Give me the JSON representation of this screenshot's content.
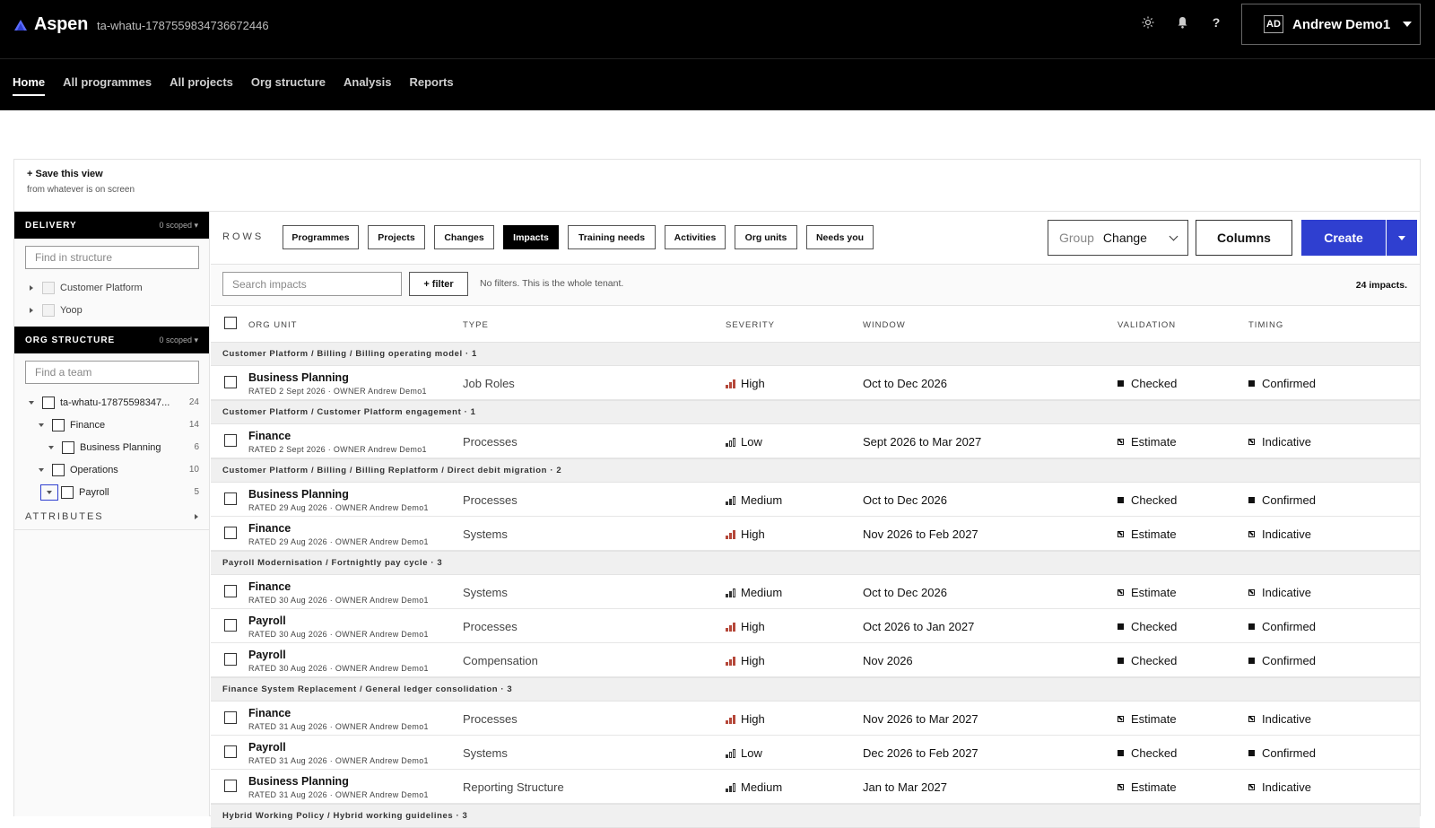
{
  "app": {
    "brand": "Aspen",
    "tenant": "ta-whatu-1787559834736672446",
    "user_initials": "AD",
    "user_name": "Andrew Demo1"
  },
  "nav": [
    {
      "label": "Home",
      "active": true
    },
    {
      "label": "All programmes"
    },
    {
      "label": "All projects"
    },
    {
      "label": "Org structure"
    },
    {
      "label": "Analysis"
    },
    {
      "label": "Reports"
    }
  ],
  "save_view": {
    "title": "+ Save this view",
    "subtitle": "from whatever is on screen"
  },
  "sidebar": {
    "delivery": {
      "title": "DELIVERY",
      "scope": "0 scoped",
      "placeholder": "Find in structure",
      "items": [
        {
          "label": "Customer Platform"
        },
        {
          "label": "Yoop"
        }
      ]
    },
    "org": {
      "title": "ORG STRUCTURE",
      "scope": "0 scoped",
      "placeholder": "Find a team",
      "items": [
        {
          "label": "ta-whatu-17875598347...",
          "count": "24"
        },
        {
          "label": "Finance",
          "count": "14"
        },
        {
          "label": "Business Planning",
          "count": "6"
        },
        {
          "label": "Operations",
          "count": "10"
        },
        {
          "label": "Payroll",
          "count": "5"
        }
      ]
    },
    "attributes": "ATTRIBUTES"
  },
  "rows": {
    "label": "ROWS",
    "buttons": [
      "Programmes",
      "Projects",
      "Changes",
      "Impacts",
      "Training needs",
      "Activities",
      "Org units",
      "Needs you"
    ],
    "active": "Impacts"
  },
  "toolbar": {
    "group_label": "Group",
    "group_value": "Change",
    "columns": "Columns",
    "create": "Create"
  },
  "filter": {
    "search_placeholder": "Search impacts",
    "filter_btn": "+ filter",
    "note": "No filters. This is the whole tenant.",
    "count": "24 impacts."
  },
  "table": {
    "headers": [
      "ORG UNIT",
      "TYPE",
      "SEVERITY",
      "WINDOW",
      "VALIDATION",
      "TIMING"
    ],
    "groups": [
      {
        "title": "Customer Platform / Billing / Billing operating model · 1",
        "rows": [
          {
            "unit": "Business Planning",
            "meta": "RATED 2 Sept 2026 · OWNER Andrew Demo1",
            "type": "Job Roles",
            "severity": "High",
            "window": "Oct to Dec 2026",
            "validation": "Checked",
            "timing": "Confirmed"
          }
        ]
      },
      {
        "title": "Customer Platform / Customer Platform engagement · 1",
        "rows": [
          {
            "unit": "Finance",
            "meta": "RATED 2 Sept 2026 · OWNER Andrew Demo1",
            "type": "Processes",
            "severity": "Low",
            "window": "Sept 2026 to Mar 2027",
            "validation": "Estimate",
            "timing": "Indicative"
          }
        ]
      },
      {
        "title": "Customer Platform / Billing / Billing Replatform / Direct debit migration · 2",
        "rows": [
          {
            "unit": "Business Planning",
            "meta": "RATED 29 Aug 2026 · OWNER Andrew Demo1",
            "type": "Processes",
            "severity": "Medium",
            "window": "Oct to Dec 2026",
            "validation": "Checked",
            "timing": "Confirmed"
          },
          {
            "unit": "Finance",
            "meta": "RATED 29 Aug 2026 · OWNER Andrew Demo1",
            "type": "Systems",
            "severity": "High",
            "window": "Nov 2026 to Feb 2027",
            "validation": "Estimate",
            "timing": "Indicative"
          }
        ]
      },
      {
        "title": "Payroll Modernisation / Fortnightly pay cycle · 3",
        "rows": [
          {
            "unit": "Finance",
            "meta": "RATED 30 Aug 2026 · OWNER Andrew Demo1",
            "type": "Systems",
            "severity": "Medium",
            "window": "Oct to Dec 2026",
            "validation": "Estimate",
            "timing": "Indicative"
          },
          {
            "unit": "Payroll",
            "meta": "RATED 30 Aug 2026 · OWNER Andrew Demo1",
            "type": "Processes",
            "severity": "High",
            "window": "Oct 2026 to Jan 2027",
            "validation": "Checked",
            "timing": "Confirmed"
          },
          {
            "unit": "Payroll",
            "meta": "RATED 30 Aug 2026 · OWNER Andrew Demo1",
            "type": "Compensation",
            "severity": "High",
            "window": "Nov 2026",
            "validation": "Checked",
            "timing": "Confirmed"
          }
        ]
      },
      {
        "title": "Finance System Replacement / General ledger consolidation · 3",
        "rows": [
          {
            "unit": "Finance",
            "meta": "RATED 31 Aug 2026 · OWNER Andrew Demo1",
            "type": "Processes",
            "severity": "High",
            "window": "Nov 2026 to Mar 2027",
            "validation": "Estimate",
            "timing": "Indicative"
          },
          {
            "unit": "Payroll",
            "meta": "RATED 31 Aug 2026 · OWNER Andrew Demo1",
            "type": "Systems",
            "severity": "Low",
            "window": "Dec 2026 to Feb 2027",
            "validation": "Checked",
            "timing": "Confirmed"
          },
          {
            "unit": "Business Planning",
            "meta": "RATED 31 Aug 2026 · OWNER Andrew Demo1",
            "type": "Reporting Structure",
            "severity": "Medium",
            "window": "Jan to Mar 2027",
            "validation": "Estimate",
            "timing": "Indicative"
          }
        ]
      },
      {
        "title": "Hybrid Working Policy / Hybrid working guidelines · 3",
        "rows": []
      }
    ]
  },
  "colors": {
    "accent": "#2f3fd0",
    "severity_high": "#b5483a",
    "severity_medium": "#333333",
    "severity_low": "#333333"
  }
}
